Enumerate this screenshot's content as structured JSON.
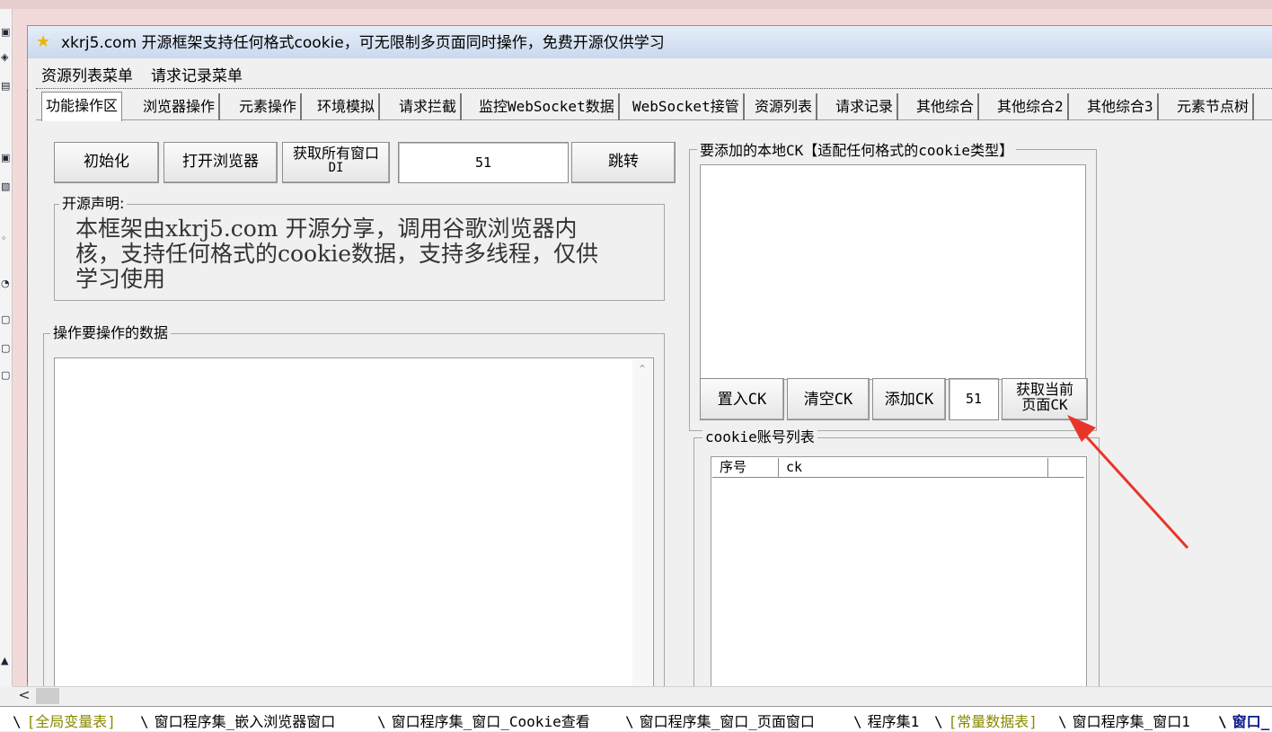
{
  "window": {
    "title": "xkrj5.com 开源框架支持任何格式cookie，可无限制多页面同时操作，免费开源仅供学习"
  },
  "menu": [
    "资源列表菜单",
    "请求记录菜单"
  ],
  "tabs": [
    "功能操作区",
    "浏览器操作",
    "元素操作",
    "环境模拟",
    "请求拦截",
    "监控WebSocket数据",
    "WebSocket接管",
    "资源列表",
    "请求记录",
    "其他综合",
    "其他综合2",
    "其他综合3",
    "元素节点树"
  ],
  "active_tab": "功能操作区",
  "left": {
    "btn_init": "初始化",
    "btn_open_browser": "打开浏览器",
    "btn_get_windows_line1": "获取所有窗口",
    "btn_get_windows_line2": "DI",
    "window_index_value": "51",
    "btn_jump": "跳转",
    "notice_title": "开源声明:",
    "notice_text": "本框架由xkrj5.com 开源分享，调用谷歌浏览器内核，支持任何格式的cookie数据，支持多线程，仅供学习使用",
    "data_group_title": "操作要操作的数据"
  },
  "right": {
    "ck_group_title": "要添加的本地CK【适配任何格式的cookie类型】",
    "btn_set_ck": "置入CK",
    "btn_clear_ck": "清空CK",
    "btn_add_ck": "添加CK",
    "ck_index_value": "51",
    "btn_get_page_ck_line1": "获取当前",
    "btn_get_page_ck_line2": "页面CK",
    "list_group_title": "cookie账号列表",
    "list_columns": [
      "序号",
      "ck"
    ]
  },
  "file_tabs": [
    {
      "label": "[全局变量表]",
      "style": "olive"
    },
    {
      "label": "窗口程序集_嵌入浏览器窗口",
      "style": "normal"
    },
    {
      "label": "窗口程序集_窗口_Cookie查看",
      "style": "normal"
    },
    {
      "label": "窗口程序集_窗口_页面窗口",
      "style": "normal"
    },
    {
      "label": "程序集1",
      "style": "normal"
    },
    {
      "label": "[常量数据表]",
      "style": "olive"
    },
    {
      "label": "窗口程序集_窗口1",
      "style": "normal"
    },
    {
      "label": "窗口_",
      "style": "active"
    }
  ],
  "colors": {
    "arrow": "#e8352a",
    "title_bar": "#c9d9ee",
    "design_bg": "#f3dada"
  }
}
